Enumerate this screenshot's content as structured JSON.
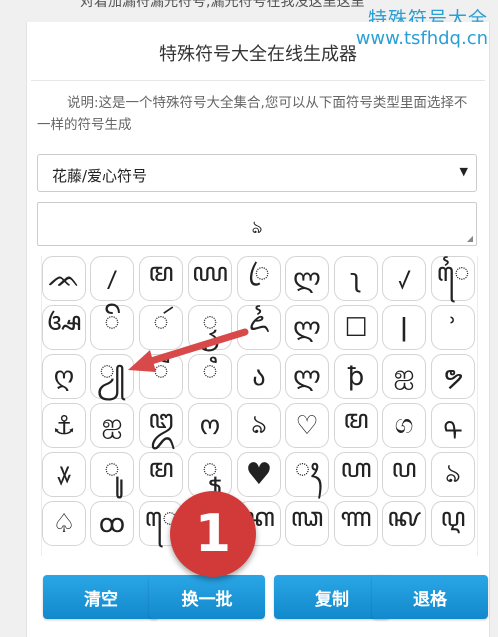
{
  "top_cut_text": "对着加漏符漏光符号,漏光符号在我没这里这里",
  "watermark": {
    "line1": "特殊符号大全",
    "line2": "www.tsfhdq.cn"
  },
  "title": "特殊符号大全在线生成器",
  "description": "说明:这是一个特殊符号大全集合,您可以从下面符号类型里面选择不一样的符号生成",
  "select": {
    "value": "花藤/爱心符号",
    "caret": "▼"
  },
  "output": {
    "value": "ঌ",
    "grip": "◢"
  },
  "symbols": [
    [
      "ᨏ",
      "ꤷ",
      "ꦩ",
      "ꦪ",
      "ꦿ",
      "ლ",
      "ʅ",
      "ꤶ",
      "ꦻ"
    ],
    [
      "ꦄ",
      "ꦼ",
      "ꦂ",
      "ꦽ",
      "ꦍ",
      "ლ",
      "☐",
      "ǀ",
      "ʾ"
    ],
    [
      "ღ",
      "ꦾ",
      "ꦷ",
      "ꦶ",
      "ა",
      "ლ",
      "ꝥ",
      "ஐ",
      "ຯ"
    ],
    [
      "⚓",
      "ஐ",
      "ꦈ",
      "ო",
      "ঌ",
      "♡",
      "ꦩ",
      "ග",
      "ᠲ"
    ],
    [
      "ꤸ",
      "ꦸ",
      "ꦩ",
      "ꦹ",
      "♥",
      "ꦃ",
      "ꦲ",
      "ꦥ",
      "ঌ"
    ],
    [
      "♤",
      "ꝏ",
      "ꦺ",
      "꦳",
      "ꦏ",
      "ꦓ",
      "ꦟ",
      "ꦑ",
      "ꦉ"
    ]
  ],
  "buttons": {
    "clear": "清空",
    "refresh": "换一批",
    "copy": "复制",
    "backspace": "退格"
  },
  "badge": "1",
  "accent": "#1d96d9",
  "badge_color": "#d23a3a"
}
